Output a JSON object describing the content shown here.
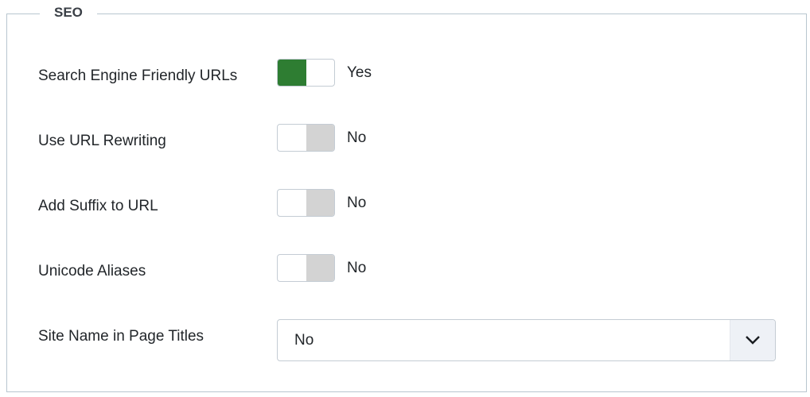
{
  "fieldset": {
    "legend": "SEO"
  },
  "fields": [
    {
      "label": "Search Engine Friendly URLs",
      "type": "switch",
      "on": true,
      "state_label": "Yes"
    },
    {
      "label": "Use URL Rewriting",
      "type": "switch",
      "on": false,
      "state_label": "No"
    },
    {
      "label": "Add Suffix to URL",
      "type": "switch",
      "on": false,
      "state_label": "No"
    },
    {
      "label": "Unicode Aliases",
      "type": "switch",
      "on": false,
      "state_label": "No"
    },
    {
      "label": "Site Name in Page Titles",
      "type": "select",
      "value": "No",
      "icon": "chevron-down-icon"
    }
  ],
  "colors": {
    "switch_on": "#2e7d32",
    "switch_off": "#d3d3d3"
  }
}
